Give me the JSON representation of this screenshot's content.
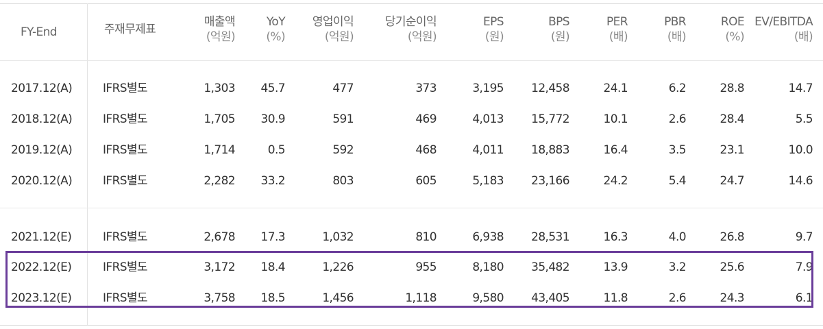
{
  "columns": [
    {
      "label": "FY-End",
      "unit": ""
    },
    {
      "label": "주재무제표",
      "unit": ""
    },
    {
      "label": "매출액",
      "unit": "(억원)"
    },
    {
      "label": "YoY",
      "unit": "(%)"
    },
    {
      "label": "영업이익",
      "unit": "(억원)"
    },
    {
      "label": "당기순이익",
      "unit": "(억원)"
    },
    {
      "label": "EPS",
      "unit": "(원)"
    },
    {
      "label": "BPS",
      "unit": "(원)"
    },
    {
      "label": "PER",
      "unit": "(배)"
    },
    {
      "label": "PBR",
      "unit": "(배)"
    },
    {
      "label": "ROE",
      "unit": "(%)"
    },
    {
      "label": "EV/EBITDA",
      "unit": "(배)"
    }
  ],
  "rows": [
    [
      "2017.12(A)",
      "IFRS별도",
      "1,303",
      "45.7",
      "477",
      "373",
      "3,195",
      "12,458",
      "24.1",
      "6.2",
      "28.8",
      "14.7"
    ],
    [
      "2018.12(A)",
      "IFRS별도",
      "1,705",
      "30.9",
      "591",
      "469",
      "4,013",
      "15,772",
      "10.1",
      "2.6",
      "28.4",
      "5.5"
    ],
    [
      "2019.12(A)",
      "IFRS별도",
      "1,714",
      "0.5",
      "592",
      "468",
      "4,011",
      "18,883",
      "16.4",
      "3.5",
      "23.1",
      "10.0"
    ],
    [
      "2020.12(A)",
      "IFRS별도",
      "2,282",
      "33.2",
      "803",
      "605",
      "5,183",
      "23,166",
      "24.2",
      "5.4",
      "24.7",
      "14.6"
    ],
    [
      "2021.12(E)",
      "IFRS별도",
      "2,678",
      "17.3",
      "1,032",
      "810",
      "6,938",
      "28,531",
      "16.3",
      "4.0",
      "26.8",
      "9.7"
    ],
    [
      "2022.12(E)",
      "IFRS별도",
      "3,172",
      "18.4",
      "1,226",
      "955",
      "8,180",
      "35,482",
      "13.9",
      "3.2",
      "25.6",
      "7.9"
    ],
    [
      "2023.12(E)",
      "IFRS별도",
      "3,758",
      "18.5",
      "1,456",
      "1,118",
      "9,580",
      "43,405",
      "11.8",
      "2.6",
      "24.3",
      "6.1"
    ]
  ],
  "colors": {
    "highlight": "#6a3d9a",
    "text": "#333333",
    "header": "#666666"
  }
}
